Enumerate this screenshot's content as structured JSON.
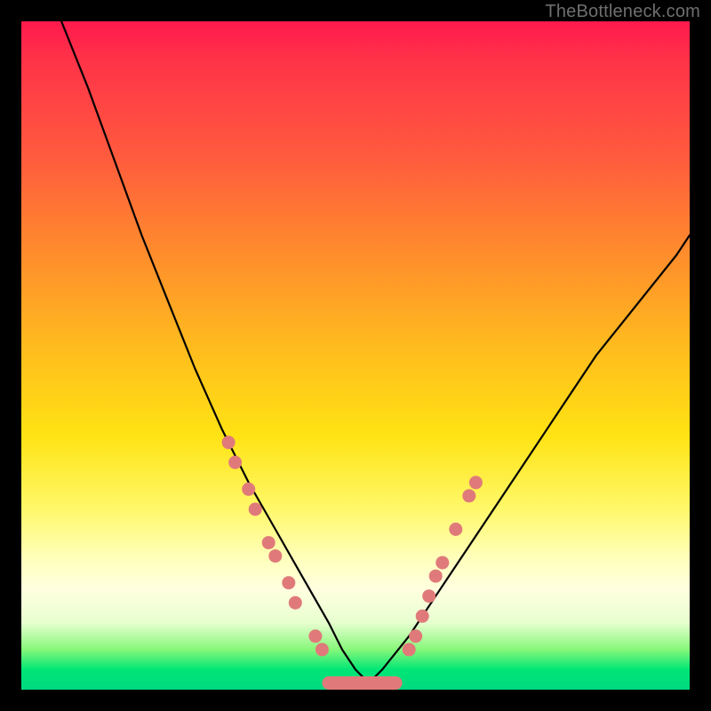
{
  "watermark": "TheBottleneck.com",
  "chart_data": {
    "type": "line",
    "title": "",
    "xlabel": "",
    "ylabel": "",
    "ylim": [
      0,
      100
    ],
    "xlim": [
      0,
      100
    ],
    "grid": false,
    "legend": false,
    "series": [
      {
        "name": "bottleneck-curve",
        "comment": "V-shaped curve; y-values estimated from the vertical gradient axis (0 at bottom / green, 100 at top / red).",
        "x": [
          6,
          10,
          14,
          18,
          22,
          26,
          30,
          34,
          38,
          42,
          46,
          48,
          50,
          52,
          54,
          58,
          62,
          66,
          70,
          74,
          78,
          82,
          86,
          90,
          94,
          98,
          100
        ],
        "y": [
          100,
          90,
          79,
          68,
          58,
          48,
          39,
          31,
          24,
          17,
          10,
          6,
          3,
          1,
          3,
          8,
          14,
          20,
          26,
          32,
          38,
          44,
          50,
          55,
          60,
          65,
          68
        ]
      }
    ],
    "highlighted_points": {
      "comment": "Pink dots marking sampled points along the curve near the bottom of the V.",
      "left_branch": [
        {
          "x": 31,
          "y": 37
        },
        {
          "x": 32,
          "y": 34
        },
        {
          "x": 34,
          "y": 30
        },
        {
          "x": 35,
          "y": 27
        },
        {
          "x": 37,
          "y": 22
        },
        {
          "x": 38,
          "y": 20
        },
        {
          "x": 40,
          "y": 16
        },
        {
          "x": 41,
          "y": 13
        },
        {
          "x": 44,
          "y": 8
        },
        {
          "x": 45,
          "y": 6
        }
      ],
      "valley": [
        {
          "x": 46,
          "y": 2
        },
        {
          "x": 48,
          "y": 1
        },
        {
          "x": 50,
          "y": 1
        },
        {
          "x": 52,
          "y": 1
        },
        {
          "x": 54,
          "y": 1
        },
        {
          "x": 56,
          "y": 2
        }
      ],
      "right_branch": [
        {
          "x": 58,
          "y": 6
        },
        {
          "x": 59,
          "y": 8
        },
        {
          "x": 60,
          "y": 11
        },
        {
          "x": 61,
          "y": 14
        },
        {
          "x": 62,
          "y": 17
        },
        {
          "x": 63,
          "y": 19
        },
        {
          "x": 65,
          "y": 24
        },
        {
          "x": 67,
          "y": 29
        },
        {
          "x": 68,
          "y": 31
        }
      ]
    },
    "background_gradient": {
      "axis": "y",
      "stops": [
        {
          "y": 100,
          "color": "#ff1a4d"
        },
        {
          "y": 50,
          "color": "#ffc41a"
        },
        {
          "y": 20,
          "color": "#fff86a"
        },
        {
          "y": 5,
          "color": "#86f77a"
        },
        {
          "y": 0,
          "color": "#00d980"
        }
      ]
    }
  }
}
